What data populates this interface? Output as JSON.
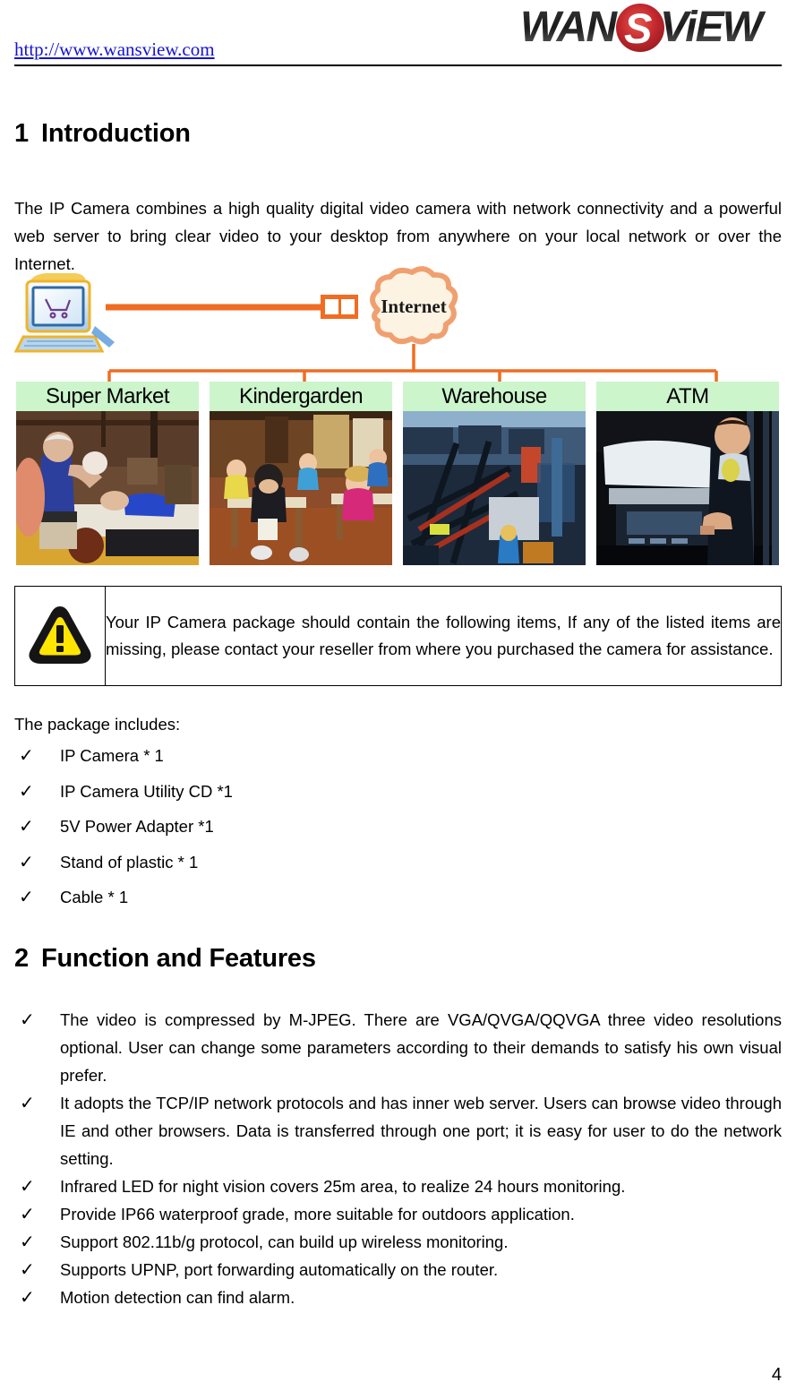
{
  "header": {
    "site_link": "http://www.wansview.com",
    "logo_text": "WANSVIEW",
    "logo_part1": "WAN",
    "logo_part2": "S",
    "logo_part3": "ViEW",
    "logo_red": "#c1272d"
  },
  "sections": {
    "intro": {
      "number": "1",
      "title": "Introduction",
      "paragraph": "The IP Camera combines a high quality digital video camera with network connectivity and a powerful web server to bring clear video to your desktop from anywhere on your local network or over the Internet."
    },
    "features": {
      "number": "2",
      "title": "Function and Features"
    }
  },
  "diagram": {
    "cloud_label": "Internet",
    "line_color": "#ef6c22",
    "cloud_fill": "#fdf3e3",
    "label_background": "#ccf5cc",
    "venues": [
      {
        "label": "Super Market",
        "photo": "supermarket-checkout-photo"
      },
      {
        "label": "Kindergarden",
        "photo": "kindergarten-classroom-photo"
      },
      {
        "label": "Warehouse",
        "photo": "warehouse-shelving-photo"
      },
      {
        "label": "ATM",
        "photo": "atm-user-photo"
      }
    ],
    "pc_icon": "desktop-computer-icon",
    "router_icon": "network-connector-icon"
  },
  "notice": {
    "icon": "warning-triangle-icon",
    "icon_fill": "#ffe500",
    "text": "Your IP Camera package should contain the following items, If any of the listed items are missing, please contact your reseller from where you purchased the camera for assistance."
  },
  "package": {
    "lead": "The package includes:",
    "bullet_glyph": "✓",
    "items": [
      "IP Camera * 1",
      "IP Camera Utility CD *1",
      "5V Power Adapter *1",
      "Stand of plastic * 1",
      "Cable * 1"
    ]
  },
  "features": {
    "bullet_glyph": "✓",
    "items": [
      "The video is compressed by M-JPEG. There are VGA/QVGA/QQVGA three video resolutions optional. User can change some parameters according to their demands to satisfy his own visual prefer.",
      "It adopts the TCP/IP network protocols and has inner web server. Users can browse video through IE and other browsers. Data is transferred through one port; it is easy for user to do the network setting.",
      "Infrared LED for night vision covers 25m area, to realize 24 hours monitoring.",
      "Provide IP66 waterproof grade, more suitable for outdoors application.",
      "Support 802.11b/g protocol, can build up wireless monitoring.",
      "Supports UPNP, port forwarding automatically on the router.",
      "Motion detection can find alarm."
    ]
  },
  "footer": {
    "page_number": "4"
  }
}
